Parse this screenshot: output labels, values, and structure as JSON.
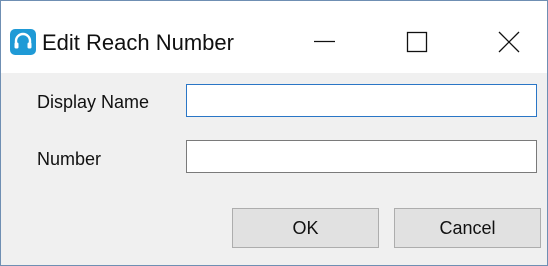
{
  "window": {
    "title": "Edit Reach Number",
    "app_icon": "headset-icon",
    "controls": {
      "minimize_icon": "minimize-icon",
      "maximize_icon": "maximize-icon",
      "close_icon": "close-icon"
    }
  },
  "form": {
    "display_name": {
      "label": "Display Name",
      "value": "",
      "focused": true
    },
    "number": {
      "label": "Number",
      "value": ""
    }
  },
  "buttons": {
    "ok_label": "OK",
    "cancel_label": "Cancel"
  },
  "colors": {
    "app_icon": "#1f9ad6",
    "focus_border": "#2a76c6",
    "window_border": "#6f8fb3",
    "button_face": "#e1e1e1",
    "dialog_background": "#f0f0f0"
  }
}
